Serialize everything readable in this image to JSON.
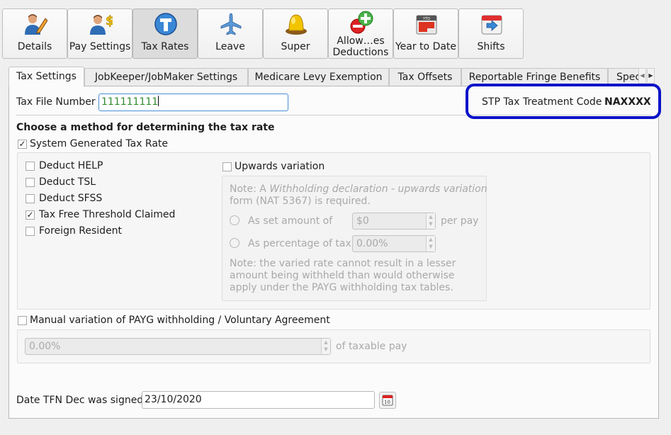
{
  "toolbar": {
    "buttons": [
      {
        "label": "Details",
        "icon": "person-pencil-icon",
        "active": false
      },
      {
        "label": "Pay Settings",
        "icon": "person-dollar-icon",
        "active": false
      },
      {
        "label": "Tax Rates",
        "icon": "tax-t-icon",
        "active": true
      },
      {
        "label": "Leave",
        "icon": "airplane-icon",
        "active": false
      },
      {
        "label": "Super",
        "icon": "golden-egg-icon",
        "active": false
      },
      {
        "label_line1": "Allow…es",
        "label_line2": "Deductions",
        "icon": "plus-minus-icon",
        "active": false
      },
      {
        "label": "Year to Date",
        "icon": "ytd-calendar-icon",
        "active": false
      },
      {
        "label": "Shifts",
        "icon": "calendar-arrow-icon",
        "active": false
      }
    ]
  },
  "tabs": [
    {
      "label": "Tax Settings",
      "active": true
    },
    {
      "label": "JobKeeper/JobMaker Settings"
    },
    {
      "label": "Medicare Levy Exemption"
    },
    {
      "label": "Tax Offsets"
    },
    {
      "label": "Reportable Fringe Benefits"
    },
    {
      "label": "Spec"
    }
  ],
  "form": {
    "tfn_label": "Tax File Number",
    "tfn_value": "111111111",
    "stp_label": "STP Tax Treatment Code",
    "stp_value": "NAXXXX",
    "method_heading": "Choose a method for determining the tax rate",
    "system_generated": {
      "label": "System Generated Tax Rate",
      "checked": true
    },
    "options": [
      {
        "label": "Deduct HELP",
        "checked": false
      },
      {
        "label": "Deduct TSL",
        "checked": false
      },
      {
        "label": "Deduct SFSS",
        "checked": false
      },
      {
        "label": "Tax Free Threshold Claimed",
        "checked": true
      },
      {
        "label": "Foreign Resident",
        "checked": false
      }
    ],
    "upwards": {
      "label": "Upwards variation",
      "checked": false,
      "note1_prefix": "Note: A ",
      "note1_italic": "Withholding declaration - upwards variation",
      "note1_suffix": "form (NAT 5367) is required.",
      "set_amount_label": "As set amount of",
      "set_amount_value": "$0",
      "per_pay": "per pay",
      "percentage_label": "As percentage of tax",
      "percentage_value": "0.00%",
      "note2_line1": "Note: the varied rate cannot result in a lesser",
      "note2_line2": "amount being withheld than would otherwise",
      "note2_line3": "apply under the PAYG withholding tax tables."
    },
    "manual": {
      "label": "Manual variation of PAYG withholding / Voluntary Agreement",
      "checked": false,
      "value": "0.00%",
      "suffix": "of taxable pay"
    },
    "date_label": "Date TFN Dec was signed",
    "date_value": "23/10/2020",
    "calendar_day": "10"
  }
}
